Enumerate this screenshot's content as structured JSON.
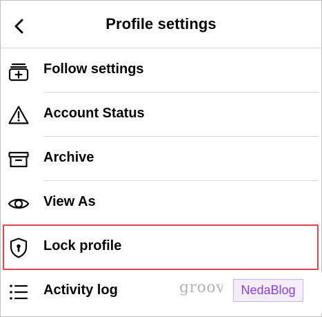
{
  "header": {
    "back_icon": "chevron-left-icon",
    "title": "Profile settings"
  },
  "menu": [
    {
      "label": "Follow settings",
      "icon": "add-stack-icon"
    },
    {
      "label": "Account Status",
      "icon": "warning-triangle-icon"
    },
    {
      "label": "Archive",
      "icon": "archive-box-icon"
    },
    {
      "label": "View As",
      "icon": "eye-icon"
    },
    {
      "label": "Lock profile",
      "icon": "shield-lock-icon",
      "highlighted": true
    },
    {
      "label": "Activity log",
      "icon": "list-icon"
    }
  ],
  "watermarks": {
    "groovy": "groov",
    "neda": "NedaBlog"
  },
  "colors": {
    "highlight": "#e0454f",
    "text": "#050505",
    "neda_text": "#8a3df0"
  }
}
